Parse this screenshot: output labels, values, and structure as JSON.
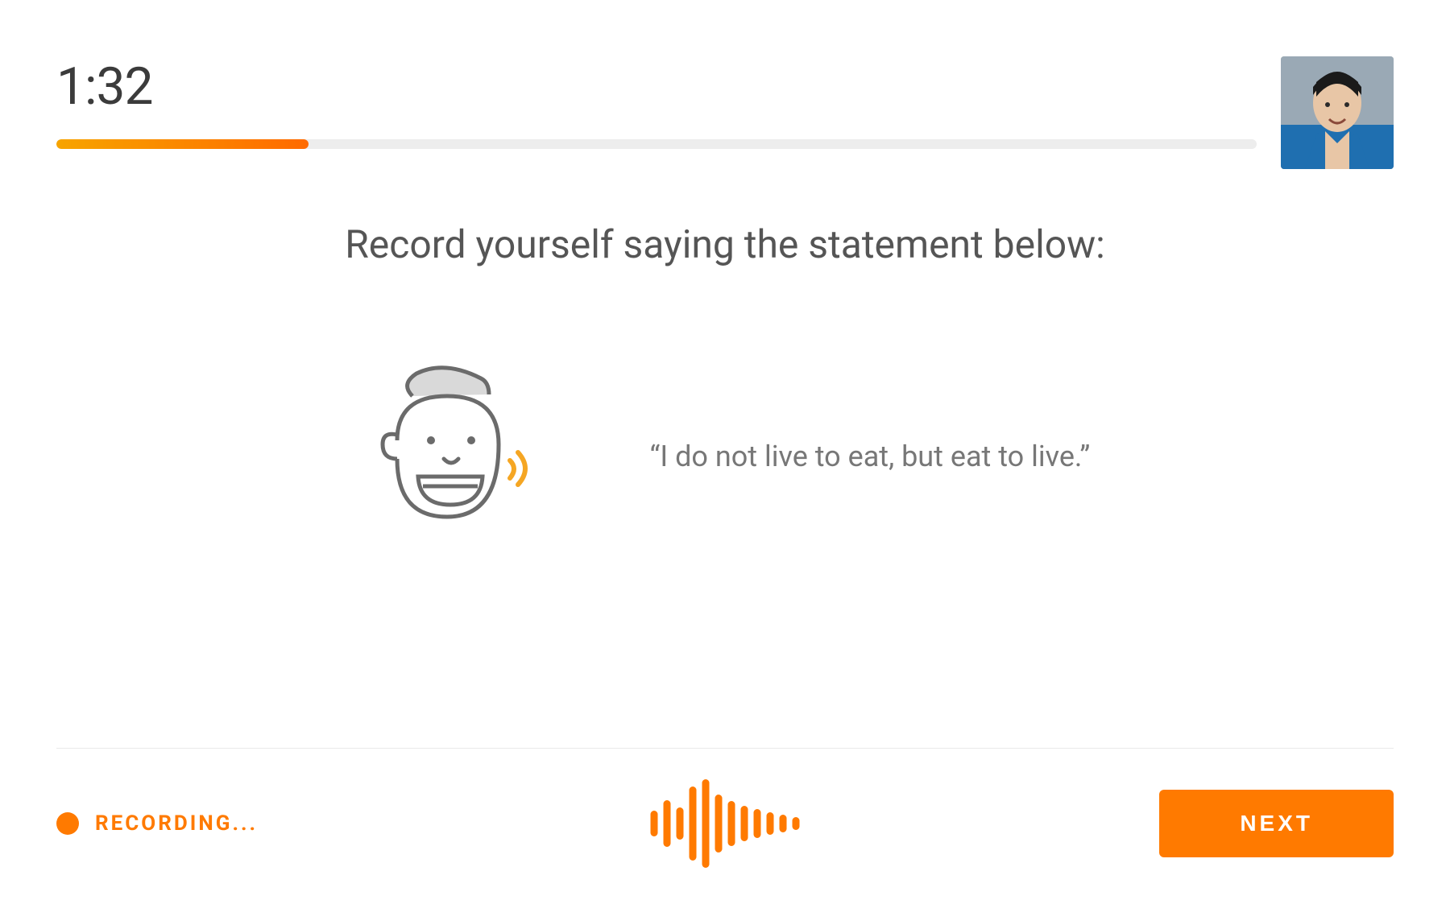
{
  "header": {
    "timer": "1:32",
    "progress_percent": 21
  },
  "content": {
    "instruction": "Record yourself saying the statement below:",
    "statement": "“I do not live to eat, but eat to live.”"
  },
  "footer": {
    "recording_label": "RECORDING...",
    "next_label": "NEXT"
  },
  "colors": {
    "accent": "#ff7a00",
    "gradient_start": "#f7a400",
    "gradient_end": "#ff6a00"
  },
  "icons": {
    "face": "speaking-face-icon",
    "waveform": "waveform-icon",
    "record_dot": "record-indicator-icon",
    "avatar": "user-avatar"
  }
}
